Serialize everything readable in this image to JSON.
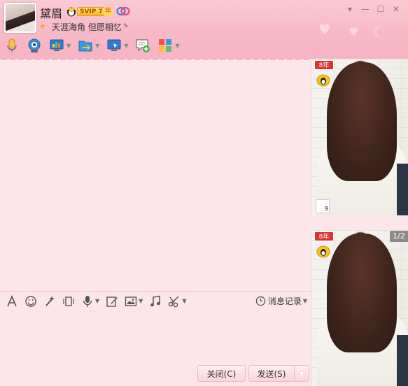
{
  "header": {
    "nickname": "黛眉",
    "svip_label": "SVIP 7",
    "year_label": "年",
    "signature": "天涯海角 但愿相忆"
  },
  "toolbar": {
    "items": [
      {
        "name": "voice-call",
        "icon": "microphone-icon"
      },
      {
        "name": "video-call",
        "icon": "webcam-icon"
      },
      {
        "name": "screen-share",
        "icon": "screen-share-icon"
      },
      {
        "name": "file-transfer",
        "icon": "folder-icon"
      },
      {
        "name": "remote-desktop",
        "icon": "remote-desktop-icon"
      },
      {
        "name": "create-discussion",
        "icon": "add-chat-icon"
      },
      {
        "name": "apps",
        "icon": "apps-grid-icon"
      }
    ]
  },
  "input_toolbar": {
    "history_label": "消息记录"
  },
  "buttons": {
    "close_label": "关闭(C)",
    "send_label": "发送(S)"
  },
  "right_panel": {
    "year_tag": "8年",
    "page_indicator": "1/2",
    "sticker_number": "9"
  },
  "colors": {
    "header_pink": "#f8b9c7",
    "body_pink": "#fde6ea",
    "button_border": "#f2b8c4"
  }
}
